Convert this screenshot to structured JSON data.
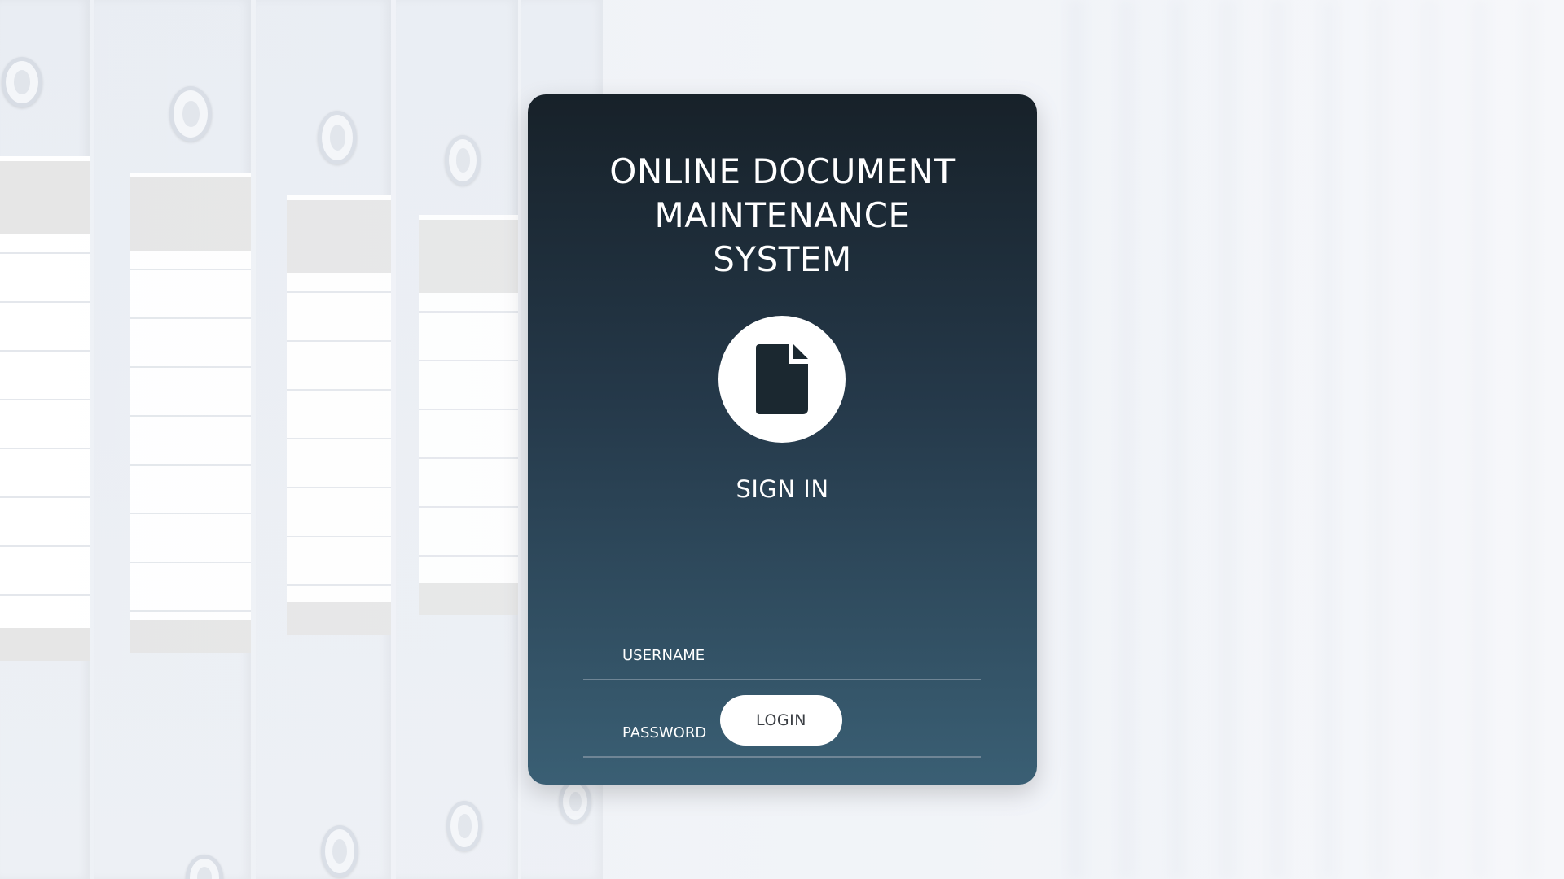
{
  "app": {
    "title_lines": [
      "ONLINE DOCUMENT",
      "MAINTENANCE",
      "SYSTEM"
    ]
  },
  "login": {
    "heading": "SIGN IN",
    "icon": "file-icon",
    "username": {
      "placeholder": "USERNAME",
      "value": ""
    },
    "password": {
      "placeholder": "PASSWORD",
      "value": ""
    },
    "submit_label": "LOGIN"
  },
  "theme": {
    "card_gradient_top": "#172129",
    "card_gradient_bottom": "#3a5f74",
    "text_color": "#ffffff",
    "button_background": "#ffffff"
  },
  "background": {
    "description_icon": "binder-shelf-background"
  }
}
